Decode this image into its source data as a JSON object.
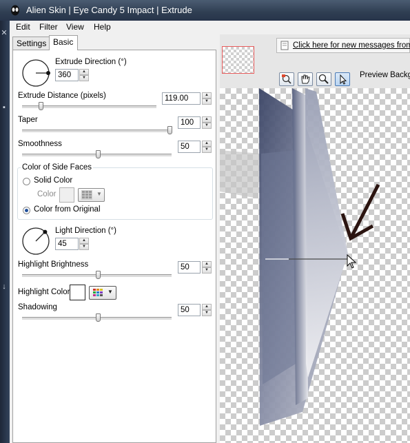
{
  "window": {
    "title": "Alien Skin | Eye Candy 5 Impact | Extrude"
  },
  "menu": [
    "Edit",
    "Filter",
    "View",
    "Help"
  ],
  "tabs": [
    "Settings",
    "Basic"
  ],
  "basic": {
    "extrude_direction_label": "Extrude Direction (°)",
    "extrude_direction_value": "360",
    "extrude_distance_label": "Extrude Distance (pixels)",
    "extrude_distance_value": "119.00",
    "taper_label": "Taper",
    "taper_value": "100",
    "smoothness_label": "Smoothness",
    "smoothness_value": "50",
    "side_faces_label": "Color of Side Faces",
    "solid_color_label": "Solid Color",
    "color_label": "Color",
    "color_from_original_label": "Color from Original",
    "side_faces_selected": "Color from Original",
    "light_direction_label": "Light Direction (°)",
    "light_direction_value": "45",
    "highlight_brightness_label": "Highlight Brightness",
    "highlight_brightness_value": "50",
    "highlight_color_label": "Highlight Color",
    "highlight_color": "#ffffff",
    "shadowing_label": "Shadowing",
    "shadowing_value": "50"
  },
  "slider_levels": {
    "extrude_distance": 0.12,
    "taper": 1.0,
    "smoothness": 0.5,
    "highlight_brightness": 0.5,
    "shadowing": 0.5
  },
  "preview": {
    "message_link": "Click here for new messages from Al",
    "preview_background_label": "Preview Backgr",
    "tools": [
      "zoom-fit-icon",
      "hand-icon",
      "magnifier-icon",
      "pointer-icon"
    ],
    "active_tool": "pointer-icon"
  },
  "colors": {
    "titlebar": "#2f3e52",
    "accent": "#1f4f9a",
    "arrow": "#2b1410"
  }
}
